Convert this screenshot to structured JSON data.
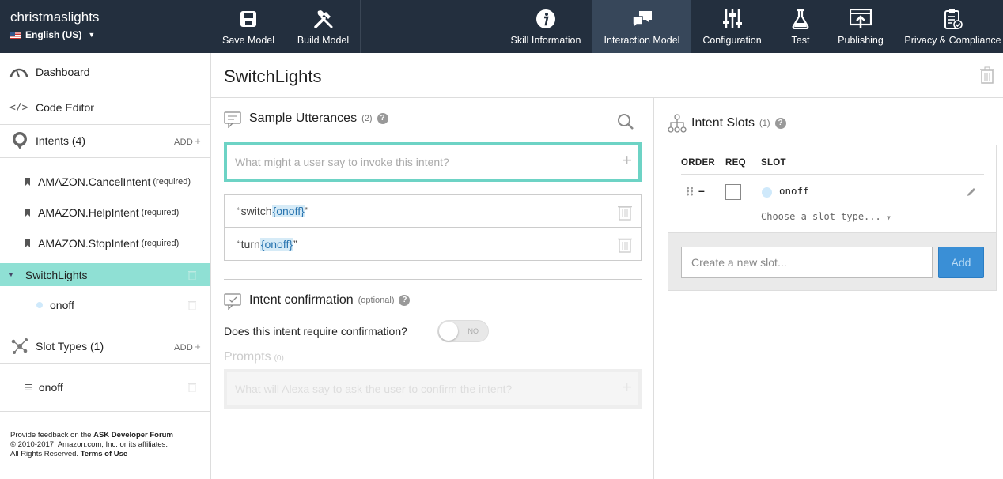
{
  "app": {
    "skill_name": "christmaslights",
    "locale": "English (US)"
  },
  "toolbar": {
    "left": [
      {
        "label": "Save Model",
        "icon": "floppy-disk-icon"
      },
      {
        "label": "Build Model",
        "icon": "tools-icon"
      }
    ],
    "right": [
      {
        "label": "Skill Information",
        "icon": "info-icon"
      },
      {
        "label": "Interaction Model",
        "icon": "chat-bubbles-icon",
        "active": true
      },
      {
        "label": "Configuration",
        "icon": "sliders-icon"
      },
      {
        "label": "Test",
        "icon": "flask-icon"
      },
      {
        "label": "Publishing",
        "icon": "publish-icon"
      },
      {
        "label": "Privacy & Compliance",
        "icon": "clipboard-check-icon"
      }
    ]
  },
  "sidebar": {
    "dashboard": "Dashboard",
    "code_editor": "Code Editor",
    "intents_header": "Intents (4)",
    "add_label": "ADD",
    "intents": [
      {
        "name": "AMAZON.CancelIntent",
        "tag": "(required)"
      },
      {
        "name": "AMAZON.HelpIntent",
        "tag": "(required)"
      },
      {
        "name": "AMAZON.StopIntent",
        "tag": "(required)"
      }
    ],
    "selected_intent": "SwitchLights",
    "selected_intent_slot": "onoff",
    "slot_types_header": "Slot Types (1)",
    "slot_types": [
      "onoff"
    ],
    "footer": {
      "line1_prefix": "Provide feedback on the ",
      "line1_link": "ASK Developer Forum",
      "line2": "© 2010-2017, Amazon.com, Inc. or its affiliates.",
      "line3_prefix": "All Rights Reserved. ",
      "line3_link": "Terms of Use"
    }
  },
  "main": {
    "title": "SwitchLights",
    "utterances": {
      "title": "Sample Utterances",
      "count": "(2)",
      "placeholder": "What might a user say to invoke this intent?",
      "items": [
        {
          "before": "“switch ",
          "slot": "{onoff}",
          "after": "”"
        },
        {
          "before": "“turn ",
          "slot": "{onoff}",
          "after": "”"
        }
      ]
    },
    "confirmation": {
      "title": "Intent confirmation",
      "optional": "(optional)",
      "question": "Does this intent require confirmation?",
      "toggle_label": "NO",
      "prompts_title": "Prompts",
      "prompts_count": "(0)",
      "prompt_placeholder": "What will Alexa say to ask the user to confirm the intent?"
    }
  },
  "slots": {
    "title": "Intent Slots",
    "count": "(1)",
    "columns": [
      "ORDER",
      "REQ",
      "SLOT"
    ],
    "rows": [
      {
        "name": "onoff",
        "type_placeholder": "Choose a slot type..."
      }
    ],
    "new_slot_placeholder": "Create a new slot...",
    "add_button": "Add"
  },
  "colors": {
    "topbar": "#232f3e",
    "active_tab": "#37475a",
    "selected_intent_bg": "#8fe0d4",
    "input_focus_border": "#6dd3c5",
    "add_button": "#3a8fd6"
  }
}
